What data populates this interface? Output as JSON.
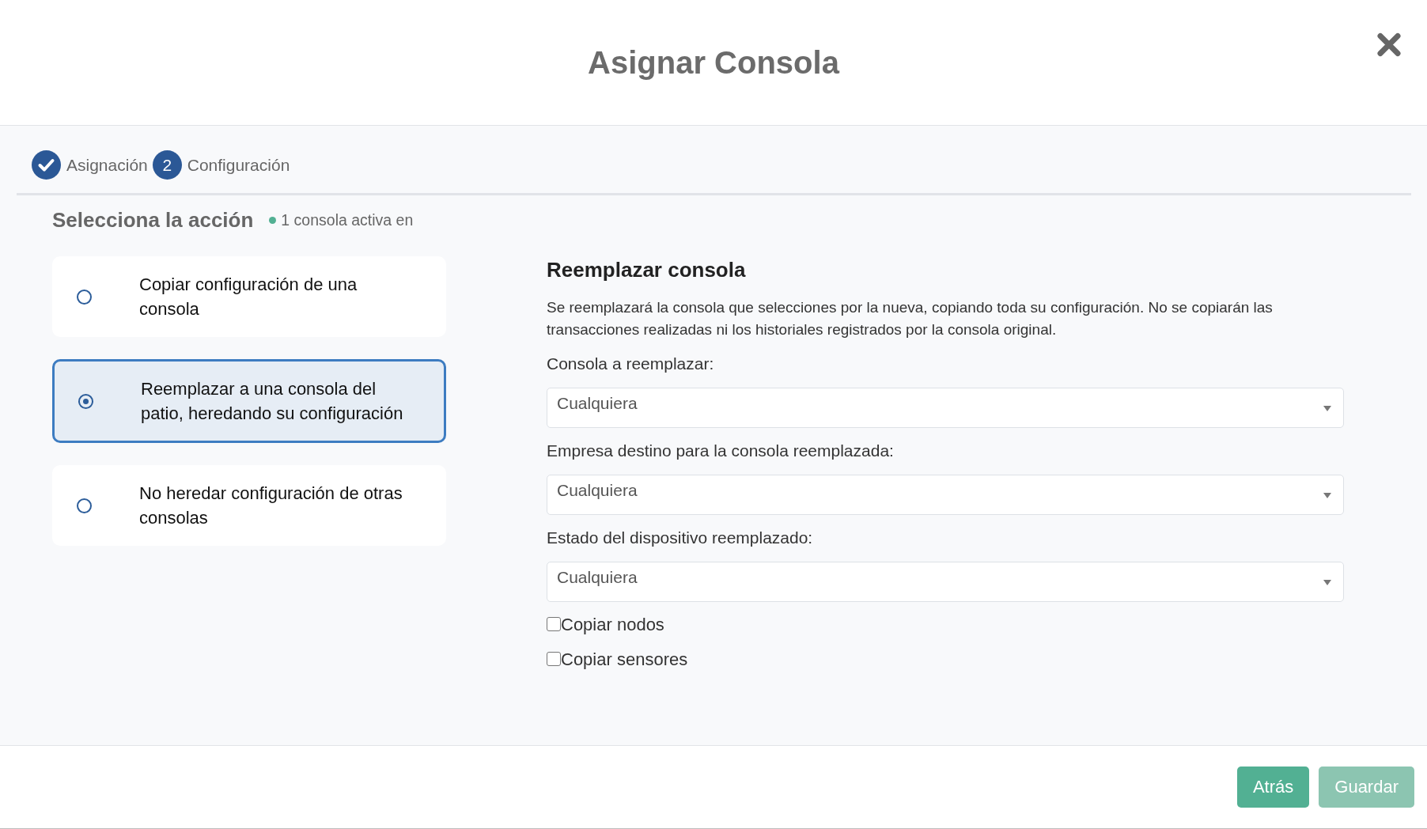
{
  "dialog": {
    "title": "Asignar Consola"
  },
  "stepper": {
    "steps": [
      {
        "label": "Asignación",
        "completed": true
      },
      {
        "number": "2",
        "label": "Configuración",
        "completed": false
      }
    ]
  },
  "action_panel": {
    "title": "Selecciona la acción",
    "status": "1 consola activa en",
    "options": [
      {
        "label": "Copiar configuración de una consola",
        "selected": false
      },
      {
        "label": "Reemplazar a una consola del patio, heredando su configuración",
        "selected": true
      },
      {
        "label": "No heredar configuración de otras consolas",
        "selected": false
      }
    ]
  },
  "detail_panel": {
    "title": "Reemplazar consola",
    "description": "Se reemplazará la consola que selecciones por la nueva, copiando toda su configuración. No se copiarán las transacciones realizadas ni los historiales registrados por la consola original.",
    "fields": [
      {
        "label": "Consola a reemplazar:",
        "value": "Cualquiera"
      },
      {
        "label": "Empresa destino para la consola reemplazada:",
        "value": "Cualquiera"
      },
      {
        "label": "Estado del dispositivo reemplazado:",
        "value": "Cualquiera"
      }
    ],
    "checkboxes": [
      {
        "label": "Copiar nodos",
        "checked": false
      },
      {
        "label": "Copiar sensores",
        "checked": false
      }
    ]
  },
  "footer": {
    "buttons": [
      {
        "label": "Atrás",
        "disabled": false
      },
      {
        "label": "Guardar",
        "disabled": true
      }
    ]
  }
}
